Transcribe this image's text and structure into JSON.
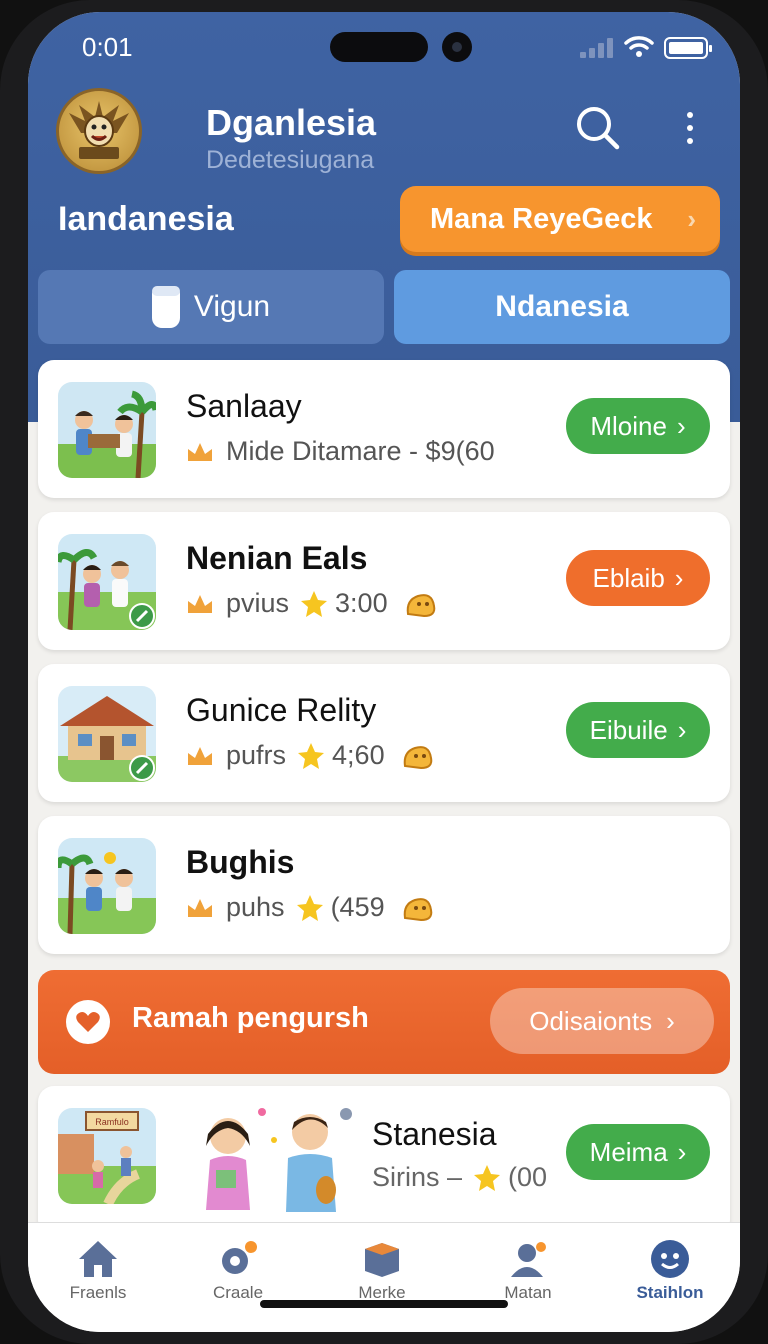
{
  "status_bar": {
    "time": "0:01"
  },
  "header": {
    "app_title": "Dganlesia",
    "app_subtitle": "Dedetesiugana",
    "region_label": "Iandanesia",
    "cta_label": "Mana ReyeGeck"
  },
  "segments": [
    {
      "label": "Vigun",
      "selected": false
    },
    {
      "label": "Ndanesia",
      "selected": true
    }
  ],
  "listings": [
    {
      "title": "Sanlaay",
      "meta_text": "Mide Ditamare - $9(60",
      "action": "Mloine",
      "action_color": "#43ac4b"
    },
    {
      "title": "Nenian Eals",
      "meta_text": "pvius",
      "rating": "3:00",
      "action": "Eblaib",
      "action_color": "#ef6e2c"
    },
    {
      "title": "Gunice Relity",
      "meta_text": "pufrs",
      "rating": "4;60",
      "action": "Eibuile",
      "action_color": "#43ac4b"
    },
    {
      "title": "Bughis",
      "meta_text": "puhs",
      "rating": "(459"
    }
  ],
  "promo_banner": {
    "text": "Ramah pengursh",
    "button_label": "Odisaionts"
  },
  "featured": {
    "title": "Stanesia",
    "meta_text": "Sirins –",
    "rating": "(00",
    "action": "Meima",
    "thumb_sign": "Ramfulo"
  },
  "tabbar": [
    {
      "label": "Fraenls",
      "icon": "home-icon",
      "active": false
    },
    {
      "label": "Craale",
      "icon": "gear-icon",
      "active": false
    },
    {
      "label": "Merke",
      "icon": "box-icon",
      "active": false
    },
    {
      "label": "Matan",
      "icon": "person-icon",
      "active": false
    },
    {
      "label": "Staihlon",
      "icon": "face-icon",
      "active": true
    }
  ],
  "colors": {
    "header": "#3f63a3",
    "accent_orange": "#f7952e",
    "green": "#43ac4b",
    "banner": "#ef6d33"
  }
}
